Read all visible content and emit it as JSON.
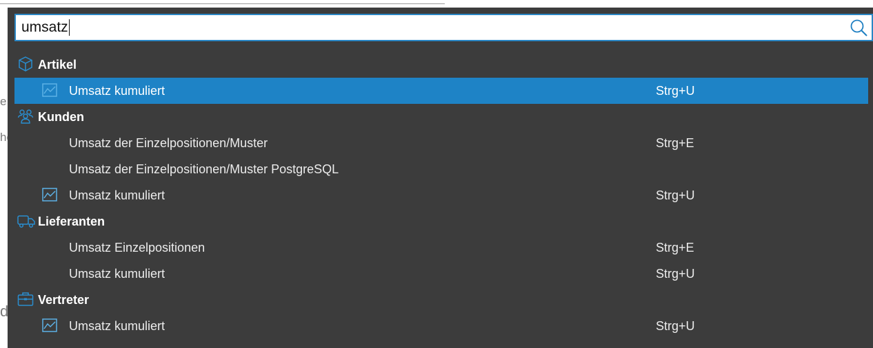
{
  "search": {
    "value": "umsatz"
  },
  "background": {
    "fragments": [
      "e",
      "hen",
      "dress"
    ]
  },
  "groups": [
    {
      "title": "Artikel",
      "icon": "cube-icon",
      "items": [
        {
          "label": "Umsatz kumuliert",
          "shortcut": "Strg+U",
          "icon": "line-chart-icon",
          "selected": true
        }
      ]
    },
    {
      "title": "Kunden",
      "icon": "users-icon",
      "items": [
        {
          "label": "Umsatz der Einzelpositionen/Muster",
          "shortcut": "Strg+E",
          "icon": "",
          "selected": false
        },
        {
          "label": "Umsatz der Einzelpositionen/Muster PostgreSQL",
          "shortcut": "",
          "icon": "",
          "selected": false
        },
        {
          "label": "Umsatz kumuliert",
          "shortcut": "Strg+U",
          "icon": "line-chart-icon",
          "selected": false
        }
      ]
    },
    {
      "title": "Lieferanten",
      "icon": "truck-icon",
      "items": [
        {
          "label": "Umsatz Einzelpositionen",
          "shortcut": "Strg+E",
          "icon": "",
          "selected": false
        },
        {
          "label": "Umsatz kumuliert",
          "shortcut": "Strg+U",
          "icon": "",
          "selected": false
        }
      ]
    },
    {
      "title": "Vertreter",
      "icon": "briefcase-icon",
      "items": [
        {
          "label": "Umsatz kumuliert",
          "shortcut": "Strg+U",
          "icon": "line-chart-icon",
          "selected": false
        }
      ]
    }
  ],
  "colors": {
    "popup_bg": "#3c3c3c",
    "selection": "#1e83c6",
    "accent_icon": "#2a8ed0",
    "search_border": "#2a86c4"
  }
}
